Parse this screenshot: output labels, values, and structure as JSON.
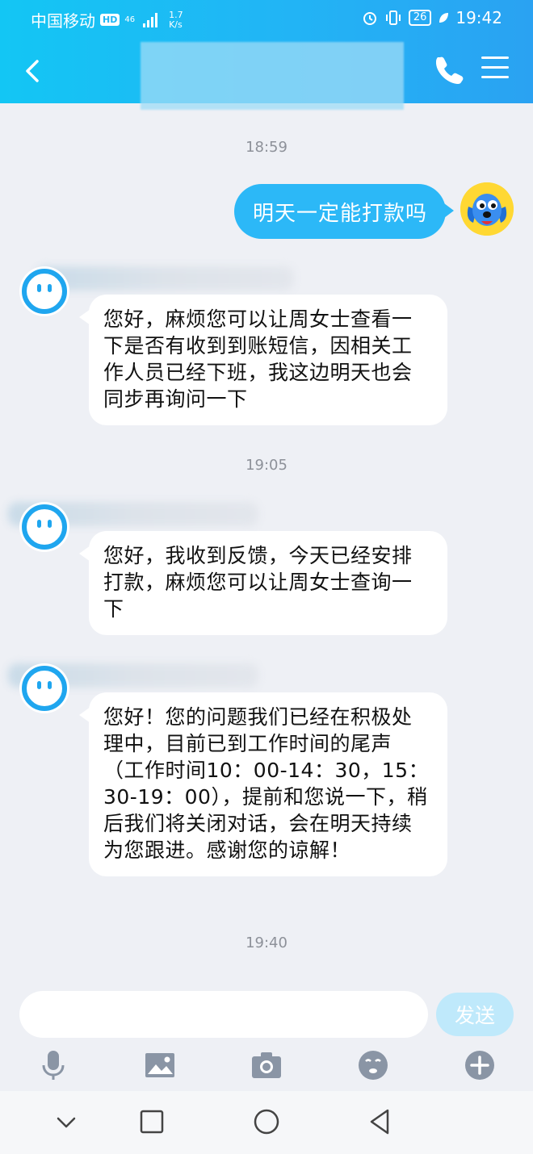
{
  "status_bar": {
    "carrier": "中国移动",
    "hd": "HD",
    "net_gen": "46",
    "net_speed": "1.7",
    "net_unit": "K/s",
    "battery": "26",
    "time": "19:42"
  },
  "header": {
    "back_icon": "chevron-left-icon",
    "phone_icon": "phone-icon",
    "menu_icon": "menu-icon"
  },
  "chat": {
    "ts1": "18:59",
    "sent_message": "明天一定能打款吗",
    "msg1": "您好，麻烦您可以让周女士查看一下是否有收到到账短信，因相关工作人员已经下班，我这边明天也会同步再询问一下",
    "ts2": "19:05",
    "msg2": "您好，我收到反馈，今天已经安排打款，麻烦您可以让周女士查询一下",
    "msg3": "您好！您的问题我们已经在积极处理中，目前已到工作时间的尾声（工作时间10：00-14：30，15：30-19：00），提前和您说一下，稍后我们将关闭对话，会在明天持续为您跟进。感谢您的谅解！",
    "ts3": "19:40"
  },
  "input": {
    "send_label": "发送",
    "tools": [
      "microphone-icon",
      "image-icon",
      "camera-icon",
      "emoji-icon",
      "plus-icon"
    ]
  },
  "nav": {
    "buttons": [
      "collapse-icon",
      "recent-apps-icon",
      "home-icon",
      "back-icon"
    ]
  },
  "colors": {
    "header_start": "#13c6f4",
    "header_end": "#2aa2f2",
    "sent_bubble": "#2cb8f7",
    "background": "#eef0f5"
  }
}
